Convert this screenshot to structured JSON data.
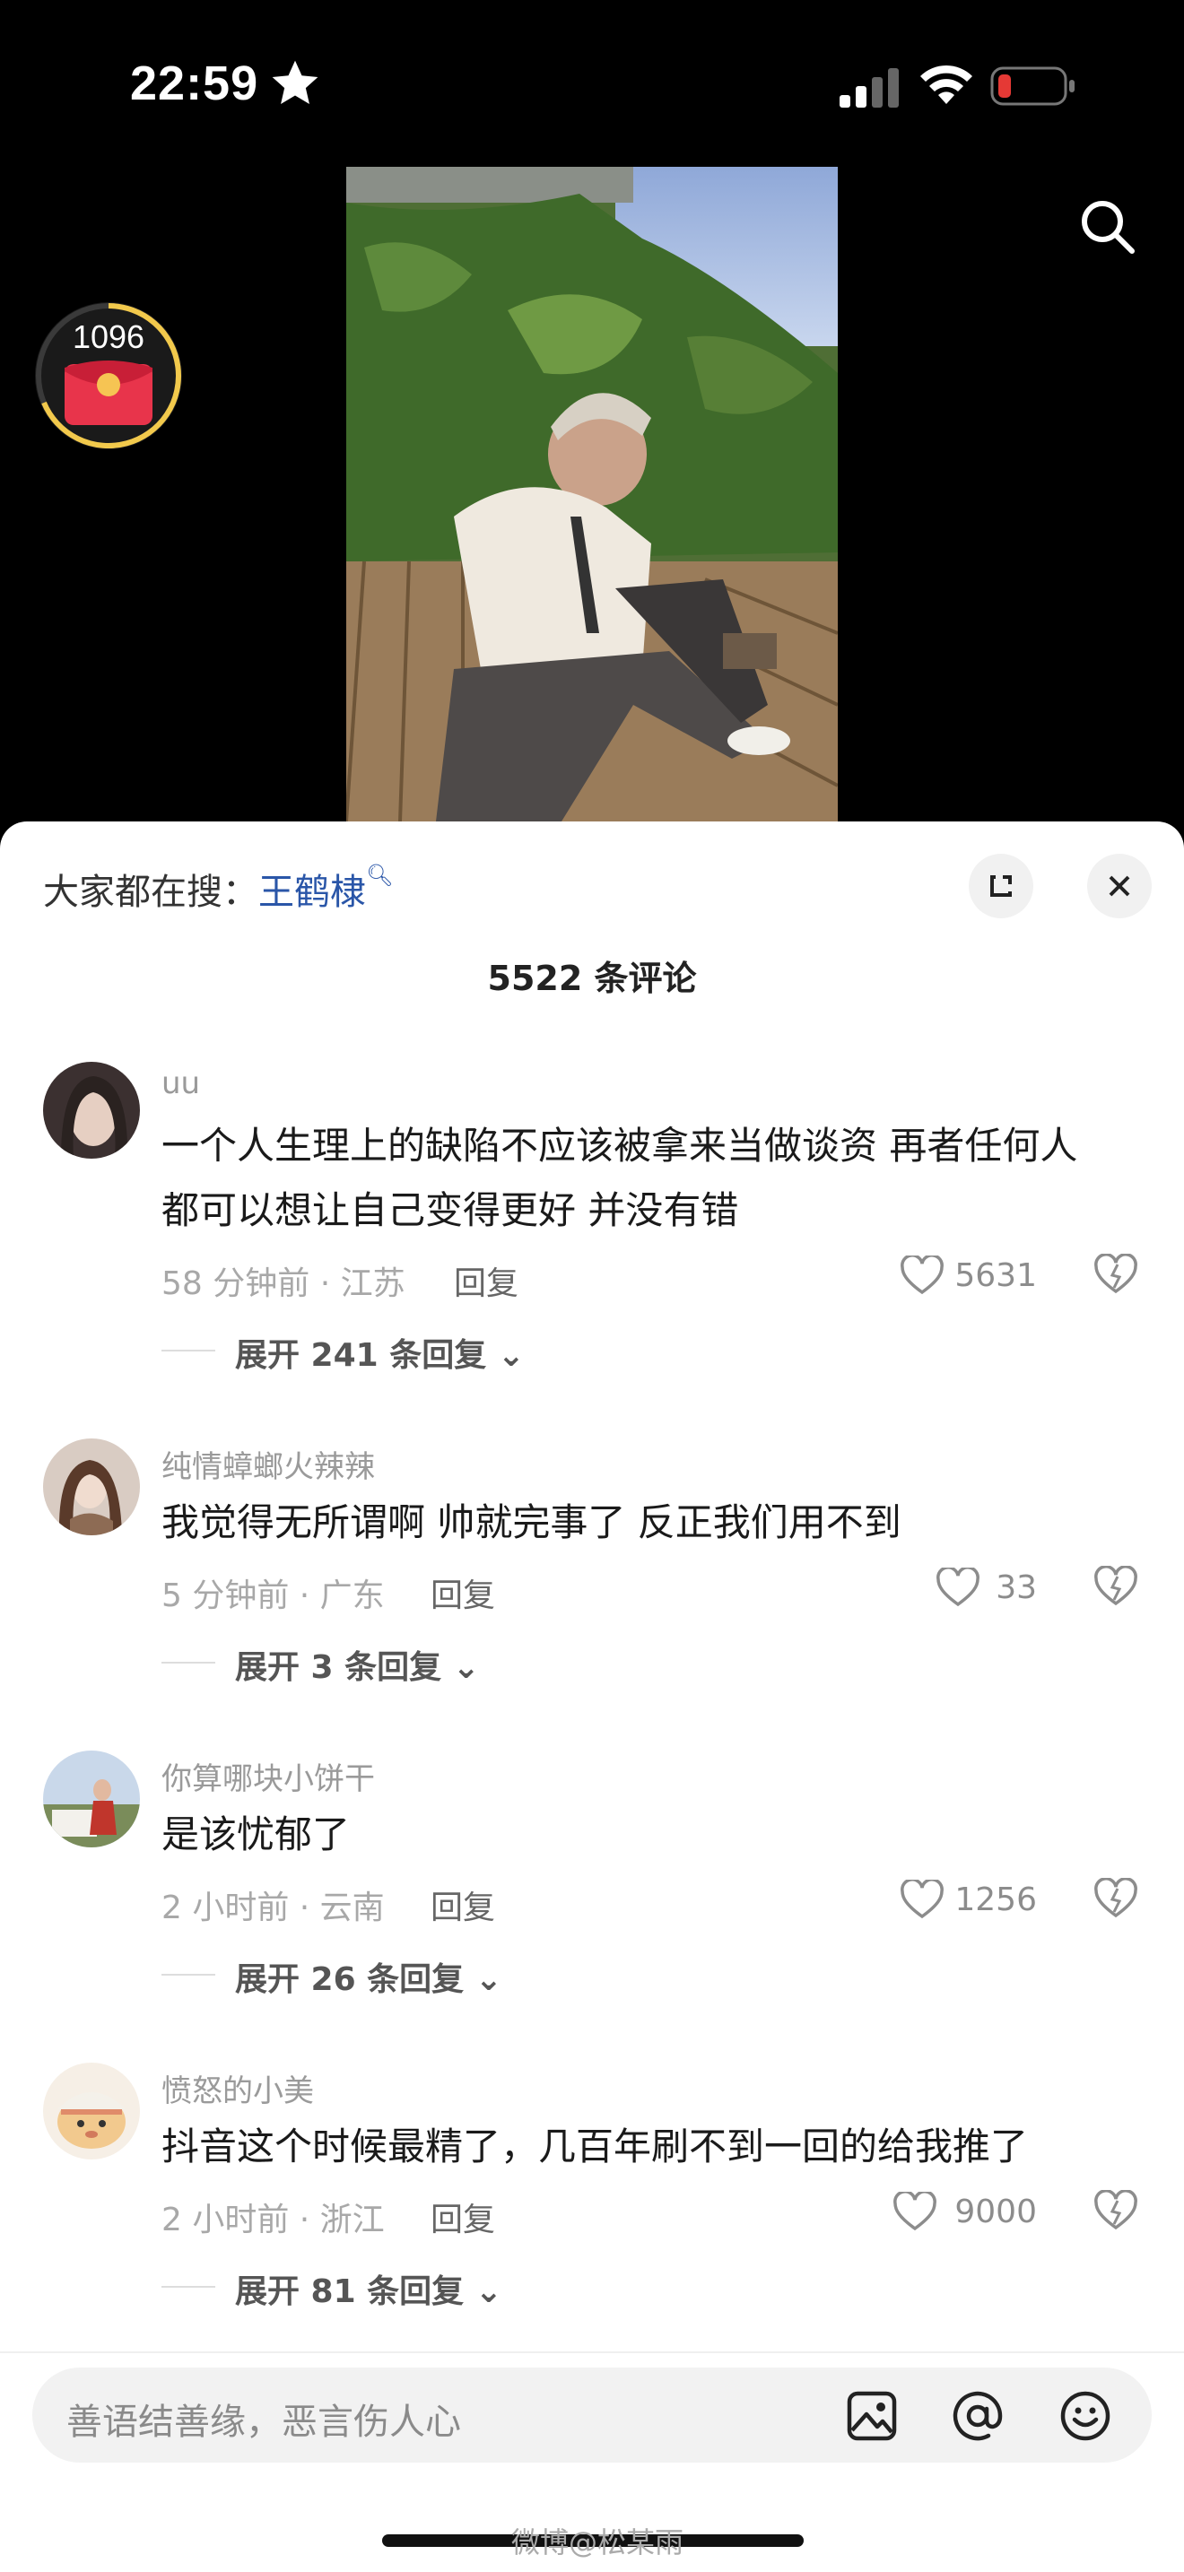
{
  "status_bar": {
    "time": "22:59"
  },
  "reward": {
    "count": "1096"
  },
  "sheet": {
    "hot_search_prefix": "大家都在搜：",
    "hot_search_keyword": "王鹤棣",
    "comment_count_title": "5522 条评论"
  },
  "comments": [
    {
      "user": "uu",
      "text_line1": "一个人生理上的缺陷不应该被拿来当做谈资 再者任何人",
      "text_line2": "都可以想让自己变得更好 并没有错",
      "meta": "58 分钟前 · 江苏",
      "reply": "回复",
      "likes": "5631",
      "expand": "展开 241 条回复"
    },
    {
      "user": "纯情蟑螂火辣辣",
      "text_line1": "我觉得无所谓啊 帅就完事了 反正我们用不到",
      "meta": "5 分钟前 · 广东",
      "reply": "回复",
      "likes": "33",
      "expand": "展开 3 条回复"
    },
    {
      "user": "你算哪块小饼干",
      "text_line1": "是该忧郁了",
      "meta": "2 小时前 · 云南",
      "reply": "回复",
      "likes": "1256",
      "expand": "展开 26 条回复"
    },
    {
      "user": "愤怒的小美",
      "text_line1": "抖音这个时候最精了，几百年刷不到一回的给我推了",
      "meta": "2 小时前 · 浙江",
      "reply": "回复",
      "likes": "9000",
      "expand": "展开 81 条回复"
    }
  ],
  "input": {
    "placeholder": "善语结善缘，恶言伤人心"
  },
  "watermark": "微博@松某雨"
}
